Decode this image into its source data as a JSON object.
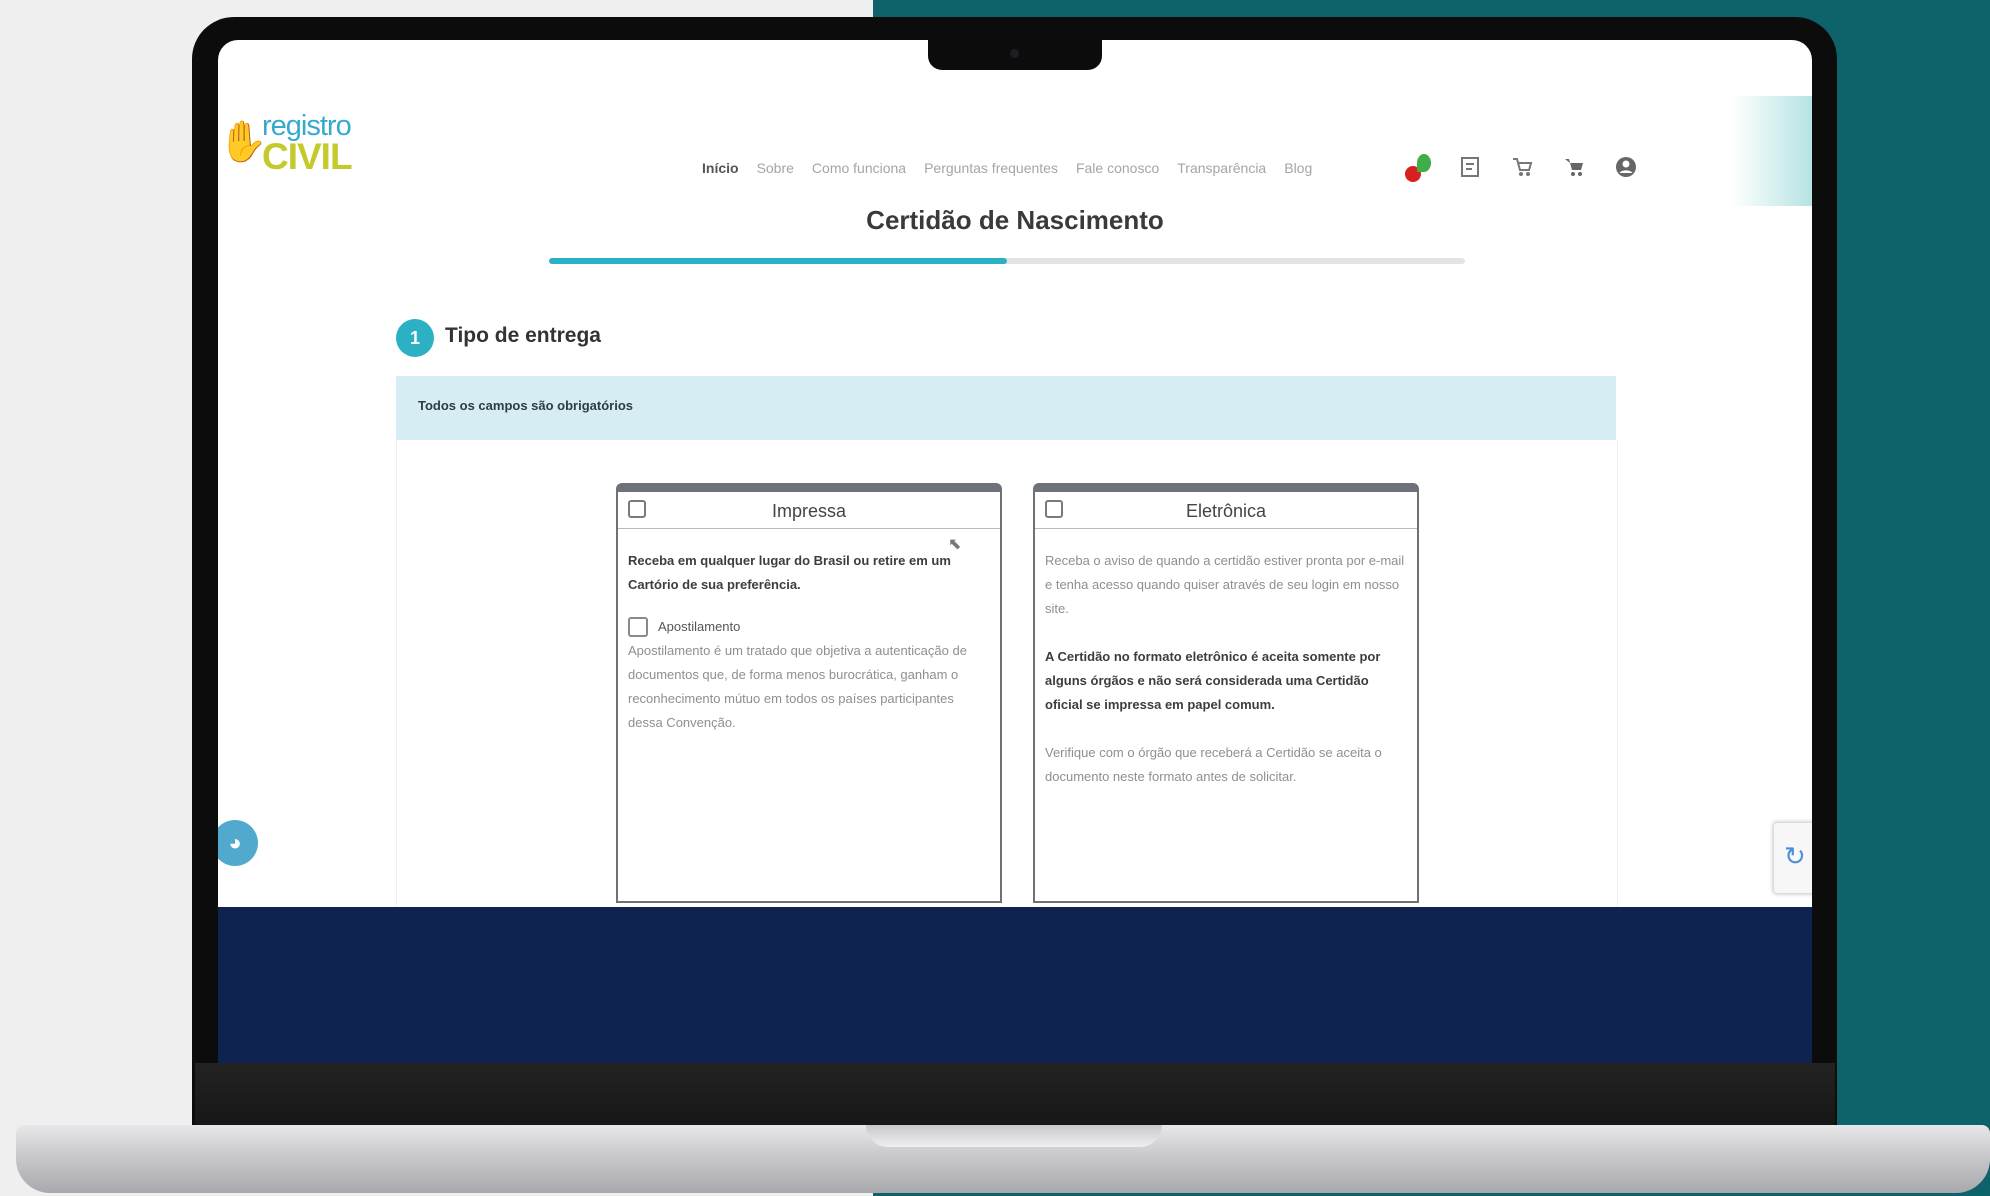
{
  "header": {
    "logo_top": "registro",
    "logo_bottom": "CIVIL",
    "nav": [
      "Início",
      "Sobre",
      "Como funciona",
      "Perguntas frequentes",
      "Fale conosco",
      "Transparência",
      "Blog"
    ]
  },
  "page": {
    "title": "Certidão de Nascimento",
    "progress_percent": 50
  },
  "step": {
    "number": "1",
    "label": "Tipo de entrega"
  },
  "notice": "Todos os campos são obrigatórios",
  "cards": {
    "impressa": {
      "title": "Impressa",
      "description": "Receba em qualquer lugar do Brasil ou retire em um Cartório de sua preferência.",
      "option_label": "Apostilamento",
      "option_description": "Apostilamento é um tratado que objetiva a autenticação de documentos que, de forma menos burocrática, ganham o reconhecimento mútuo em todos os países participantes dessa Convenção."
    },
    "eletronica": {
      "title": "Eletrônica",
      "description": "Receba o aviso de quando a certidão estiver pronta por e-mail e tenha acesso quando quiser através de seu login em nosso site.",
      "warning": "A Certidão no formato eletrônico é aceita somente por alguns órgãos e não será considerada uma Certidão oficial se impressa em papel comum.",
      "note": "Verifique com o órgão que receberá a Certidão se aceita o documento neste formato antes de solicitar."
    }
  },
  "colors": {
    "accent": "#2cb0c4",
    "notice_bg": "#d5edf3",
    "footer_bg": "#0f2351",
    "bg_right": "#0d6369"
  },
  "icons": [
    "whatsapp-icon",
    "receipt-icon",
    "cart-arrow-icon",
    "cart-icon",
    "user-icon",
    "cookie-icon",
    "recaptcha-icon"
  ]
}
